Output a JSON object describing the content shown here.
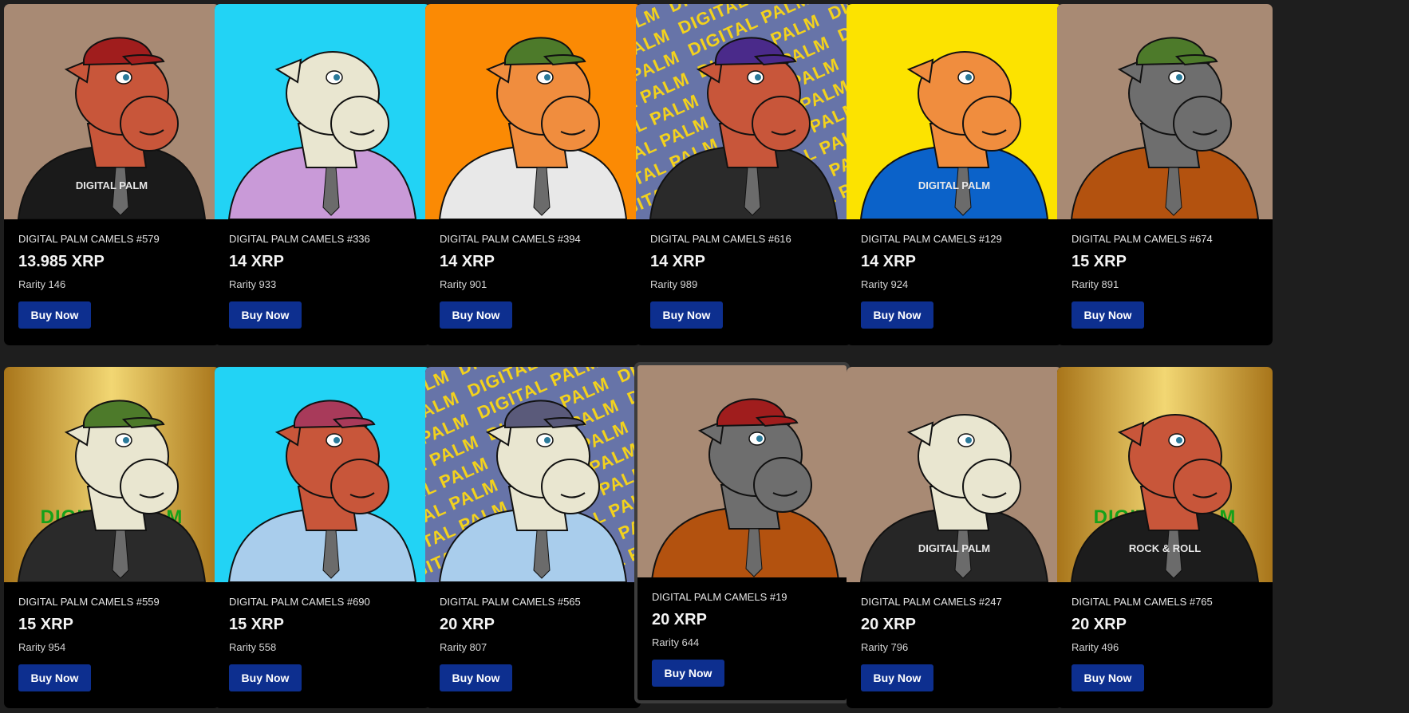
{
  "listings": [
    {
      "name": "DIGITAL PALM CAMELS #579",
      "price": "13.985 XRP",
      "rarity": "Rarity 146",
      "button": "Buy Now",
      "bg": "#a88a74",
      "head": "#c8563a",
      "hat": "#a01d1d",
      "jacket": "#1a1a1a",
      "shirt_text": "DIGITAL PALM"
    },
    {
      "name": "DIGITAL PALM CAMELS #336",
      "price": "14 XRP",
      "rarity": "Rarity 933",
      "button": "Buy Now",
      "bg": "#22d3f5",
      "head": "#e9e6d0",
      "hat": "",
      "jacket": "#c99ad8",
      "shirt_text": ""
    },
    {
      "name": "DIGITAL PALM CAMELS #394",
      "price": "14 XRP",
      "rarity": "Rarity 901",
      "button": "Buy Now",
      "bg": "#fb8a04",
      "head": "#f08d3e",
      "hat": "#4d7a2a",
      "jacket": "#e8e8e8",
      "shirt_text": ""
    },
    {
      "name": "DIGITAL PALM CAMELS #616",
      "price": "14 XRP",
      "rarity": "Rarity 989",
      "button": "Buy Now",
      "bg": "#6774a8",
      "head": "#c8563a",
      "hat": "#4a2a8a",
      "jacket": "#2a2a2a",
      "shirt_text": ""
    },
    {
      "name": "DIGITAL PALM CAMELS #129",
      "price": "14 XRP",
      "rarity": "Rarity 924",
      "button": "Buy Now",
      "bg": "#fce300",
      "head": "#f08d3e",
      "hat": "",
      "jacket": "#0b62c9",
      "shirt_text": "DIGITAL PALM"
    },
    {
      "name": "DIGITAL PALM CAMELS #674",
      "price": "15 XRP",
      "rarity": "Rarity 891",
      "button": "Buy Now",
      "bg": "#a88a74",
      "head": "#6e6e6e",
      "hat": "#4d7a2a",
      "jacket": "#b3520f",
      "shirt_text": ""
    },
    {
      "name": "DIGITAL PALM CAMELS #559",
      "price": "15 XRP",
      "rarity": "Rarity 954",
      "button": "Buy Now",
      "bg": "#c99a2e",
      "head": "#e9e6d0",
      "hat": "#4d7a2a",
      "jacket": "#2a2a2a",
      "shirt_text": "",
      "bg_word": "DIGITAL PALM"
    },
    {
      "name": "DIGITAL PALM CAMELS #690",
      "price": "15 XRP",
      "rarity": "Rarity 558",
      "button": "Buy Now",
      "bg": "#22d3f5",
      "head": "#c8563a",
      "hat": "#a83a5a",
      "jacket": "#a9cdec",
      "shirt_text": ""
    },
    {
      "name": "DIGITAL PALM CAMELS #565",
      "price": "20 XRP",
      "rarity": "Rarity 807",
      "button": "Buy Now",
      "bg": "#6774a8",
      "head": "#e9e6d0",
      "hat": "#5a5a7a",
      "jacket": "#a9cdec",
      "shirt_text": ""
    },
    {
      "name": "DIGITAL PALM CAMELS #19",
      "price": "20 XRP",
      "rarity": "Rarity 644",
      "button": "Buy Now",
      "bg": "#a88a74",
      "head": "#6e6e6e",
      "hat": "#a01d1d",
      "jacket": "#b3520f",
      "shirt_text": "",
      "selected": true
    },
    {
      "name": "DIGITAL PALM CAMELS #247",
      "price": "20 XRP",
      "rarity": "Rarity 796",
      "button": "Buy Now",
      "bg": "#a88a74",
      "head": "#e9e6d0",
      "hat": "",
      "jacket": "#262626",
      "shirt_text": "DIGITAL PALM"
    },
    {
      "name": "DIGITAL PALM CAMELS #765",
      "price": "20 XRP",
      "rarity": "Rarity 496",
      "button": "Buy Now",
      "bg": "#c99a2e",
      "head": "#c8563a",
      "hat": "",
      "jacket": "#1c1c1c",
      "shirt_text": "ROCK & ROLL",
      "bg_word": "DIGITAL PALM"
    }
  ]
}
